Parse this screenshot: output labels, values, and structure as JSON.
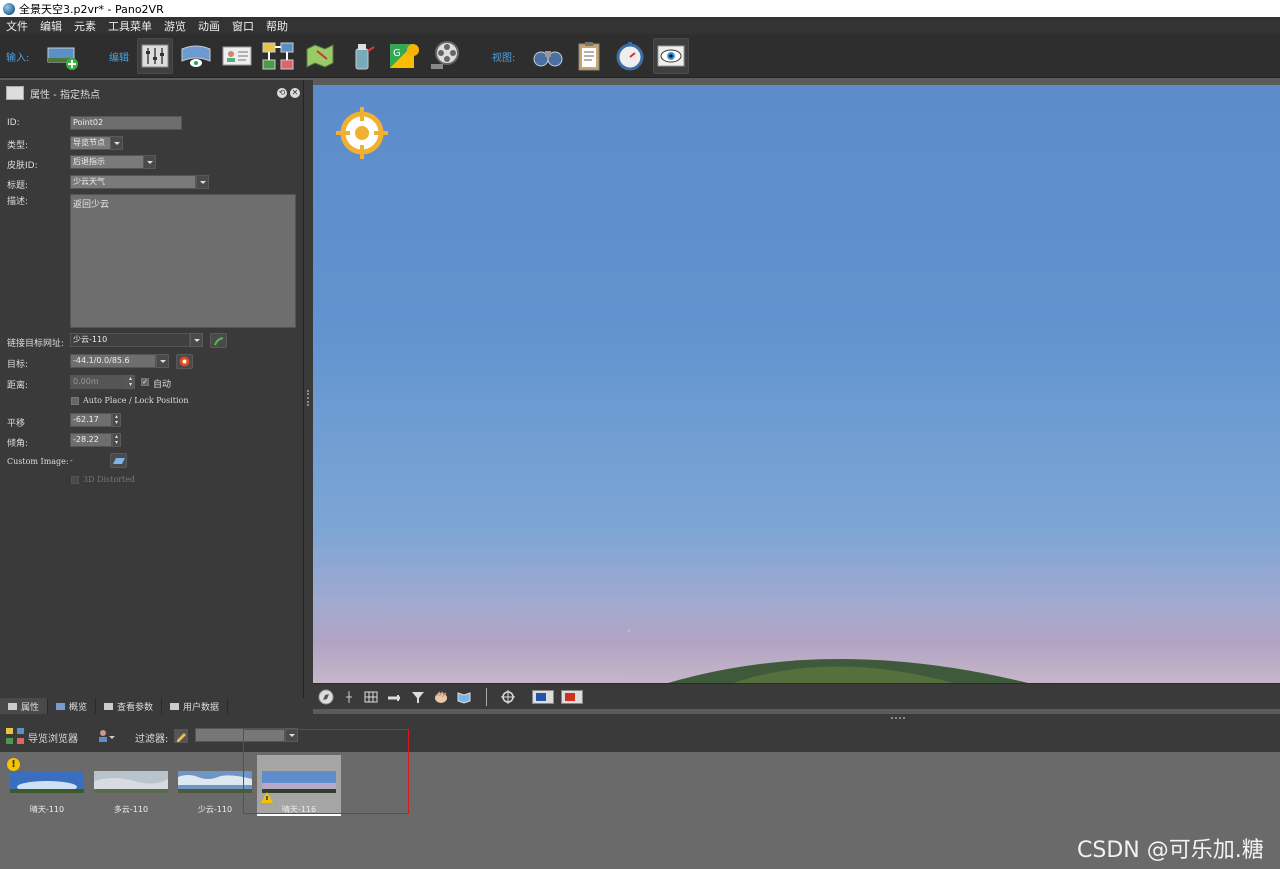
{
  "window": {
    "title": "全景天空3.p2vr* - Pano2VR"
  },
  "menu": [
    "文件",
    "编辑",
    "元素",
    "工具菜单",
    "游览",
    "动画",
    "窗口",
    "帮助"
  ],
  "toolbar": {
    "input_label": "输入:",
    "edit_label": "编辑",
    "view_label": "视图:"
  },
  "panel": {
    "title": "属性 - 指定热点",
    "id_label": "ID:",
    "id_value": "Point02",
    "type_label": "类型:",
    "type_value": "导览节点",
    "skin_label": "皮肤ID:",
    "skin_value": "后退指示",
    "title_label": "标题:",
    "title_value": "少云天气",
    "desc_label": "描述:",
    "desc_value": "返回少云",
    "link_label": "链接目标网址:",
    "link_value": "少云-110",
    "target_label": "目标:",
    "target_value": "-44.1/0.0/85.6",
    "distance_label": "距离:",
    "distance_value": "0.00m",
    "auto_label": "自动",
    "auto_place_label": "Auto Place / Lock Position",
    "pan_label": "平移",
    "pan_value": "-62.17",
    "tilt_label": "倾角:",
    "tilt_value": "-28.22",
    "custom_image_label": "Custom Image:",
    "custom_image_value": "-",
    "distorted_label": "3D Distorted"
  },
  "left_tabs": [
    "属性",
    "概览",
    "查看参数",
    "用户数据"
  ],
  "tour_browser": {
    "title": "导览浏览器",
    "filter_label": "过滤器:",
    "nodes": [
      {
        "label": "晴天-110"
      },
      {
        "label": "多云-110"
      },
      {
        "label": "少云-110"
      },
      {
        "label": "晴天-116"
      }
    ]
  },
  "watermark": "CSDN @可乐加.糖",
  "colors": {
    "accent": "#4aa3df",
    "highlight_box": "#d61b1b",
    "warning": "#f5c400"
  }
}
